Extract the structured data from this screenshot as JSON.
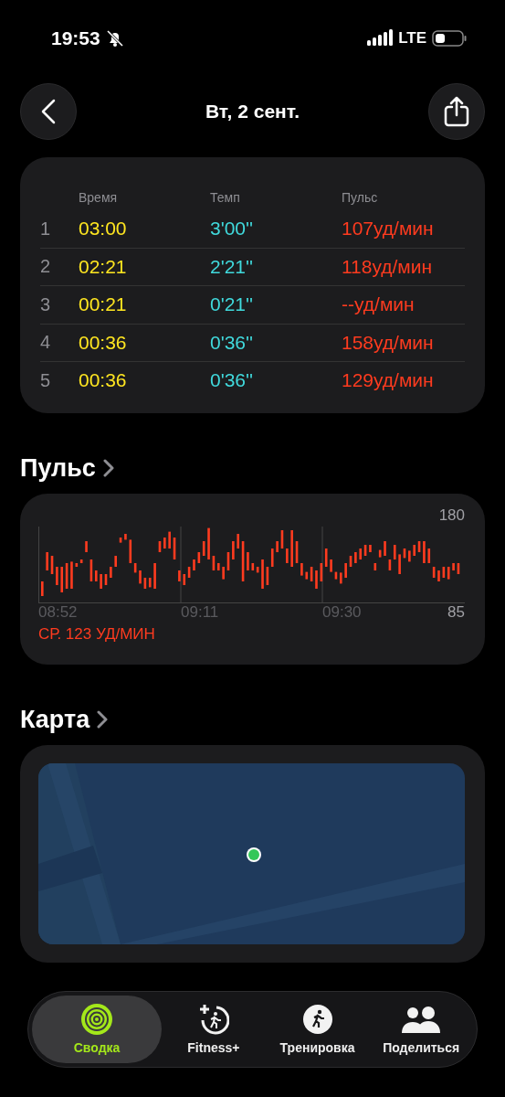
{
  "status_bar": {
    "time": "19:53",
    "network": "LTE"
  },
  "header": {
    "title": "Вт, 2 сент."
  },
  "splits": {
    "columns": [
      "Время",
      "Темп",
      "Пульс"
    ],
    "rows": [
      {
        "index": "1",
        "time": "03:00",
        "pace": "3'00''",
        "pulse": "107уд/мин"
      },
      {
        "index": "2",
        "time": "02:21",
        "pace": "2'21''",
        "pulse": "118уд/мин"
      },
      {
        "index": "3",
        "time": "00:21",
        "pace": "0'21''",
        "pulse": "--уд/мин"
      },
      {
        "index": "4",
        "time": "00:36",
        "pace": "0'36''",
        "pulse": "158уд/мин"
      },
      {
        "index": "5",
        "time": "00:36",
        "pace": "0'36''",
        "pulse": "129уд/мин"
      }
    ]
  },
  "heart_rate": {
    "title": "Пульс",
    "y_max": "180",
    "y_min": "85",
    "x_labels": [
      "08:52",
      "09:11",
      "09:30"
    ],
    "average": "СР. 123 УД/МИН"
  },
  "map": {
    "title": "Карта",
    "kind": "picture"
  },
  "tab_bar": [
    {
      "label": "Сводка",
      "kind": "rings",
      "selected": true
    },
    {
      "label": "Fitness+",
      "kind": "fitness",
      "selected": false
    },
    {
      "label": "Тренировка",
      "kind": "workout",
      "selected": false
    },
    {
      "label": "Поделиться",
      "kind": "share",
      "selected": false
    }
  ]
}
